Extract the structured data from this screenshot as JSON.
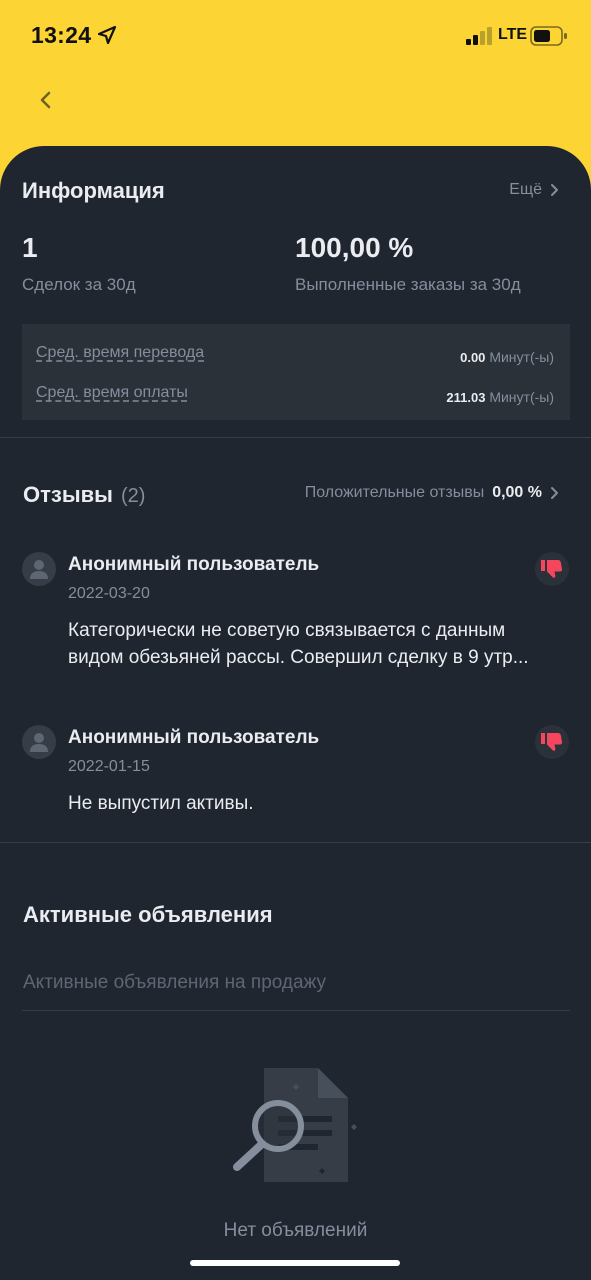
{
  "status_bar": {
    "time": "13:24",
    "network": "LTE"
  },
  "info": {
    "title": "Информация",
    "more_label": "Ещё",
    "deals_value": "1",
    "deals_label": "Сделок за 30д",
    "completed_value": "100,00 %",
    "completed_label": "Выполненные заказы за 30д",
    "transfer_label": "Сред. время перевода",
    "transfer_value": "0.00",
    "transfer_unit": "Минут(-ы)",
    "payment_label": "Сред. время оплаты",
    "payment_value": "211.03",
    "payment_unit": "Минут(-ы)"
  },
  "reviews": {
    "title": "Отзывы",
    "count": "(2)",
    "positive_label": "Положительные отзывы",
    "positive_value": "0,00 %",
    "items": [
      {
        "user": "Анонимный пользователь",
        "date": "2022-03-20",
        "text": "Категорически не советую связывается с данным видом обезьяней рассы. Совершил сделку в 9 утр..."
      },
      {
        "user": "Анонимный пользователь",
        "date": "2022-01-15",
        "text": "Не выпустил активы."
      }
    ]
  },
  "ads": {
    "title": "Активные объявления",
    "tab_label": "Активные объявления на продажу",
    "empty_text": "Нет объявлений"
  },
  "colors": {
    "accent": "#fcd535",
    "background": "#1f2630",
    "negative": "#f6465d"
  },
  "icons": [
    "location-arrow-icon",
    "signal-icon",
    "battery-icon",
    "back-arrow-icon",
    "chevron-right-icon",
    "user-avatar-icon",
    "thumbs-down-icon",
    "no-data-search-icon"
  ]
}
